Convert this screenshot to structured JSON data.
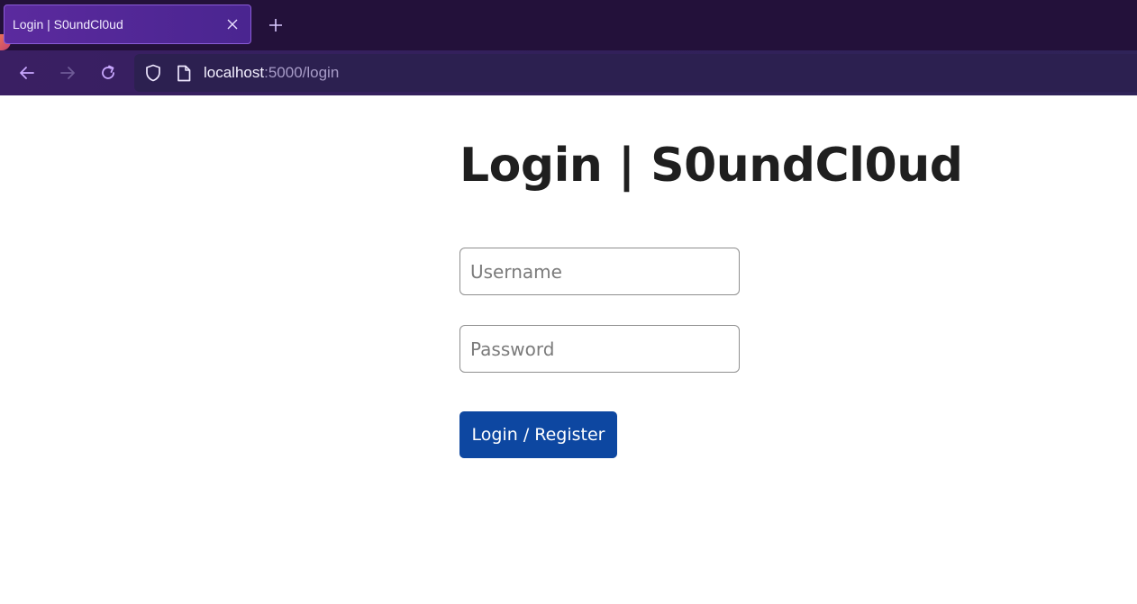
{
  "browser": {
    "tab": {
      "title": "Login | S0undCl0ud",
      "close_icon": "close-icon"
    },
    "new_tab_icon": "plus-icon",
    "nav": {
      "back_icon": "arrow-left-icon",
      "forward_icon": "arrow-right-icon",
      "reload_icon": "reload-icon"
    },
    "url": {
      "host": "localhost",
      "rest": ":5000/login"
    }
  },
  "page": {
    "title": "Login | S0undCl0ud",
    "username": {
      "value": "",
      "placeholder": "Username"
    },
    "password": {
      "value": "",
      "placeholder": "Password"
    },
    "submit_label": "Login / Register"
  },
  "colors": {
    "chrome_bg": "#23113a",
    "tab_bg": "#5b2a9e",
    "button_bg": "#0d47a1",
    "title_text": "#1f1f1f"
  }
}
